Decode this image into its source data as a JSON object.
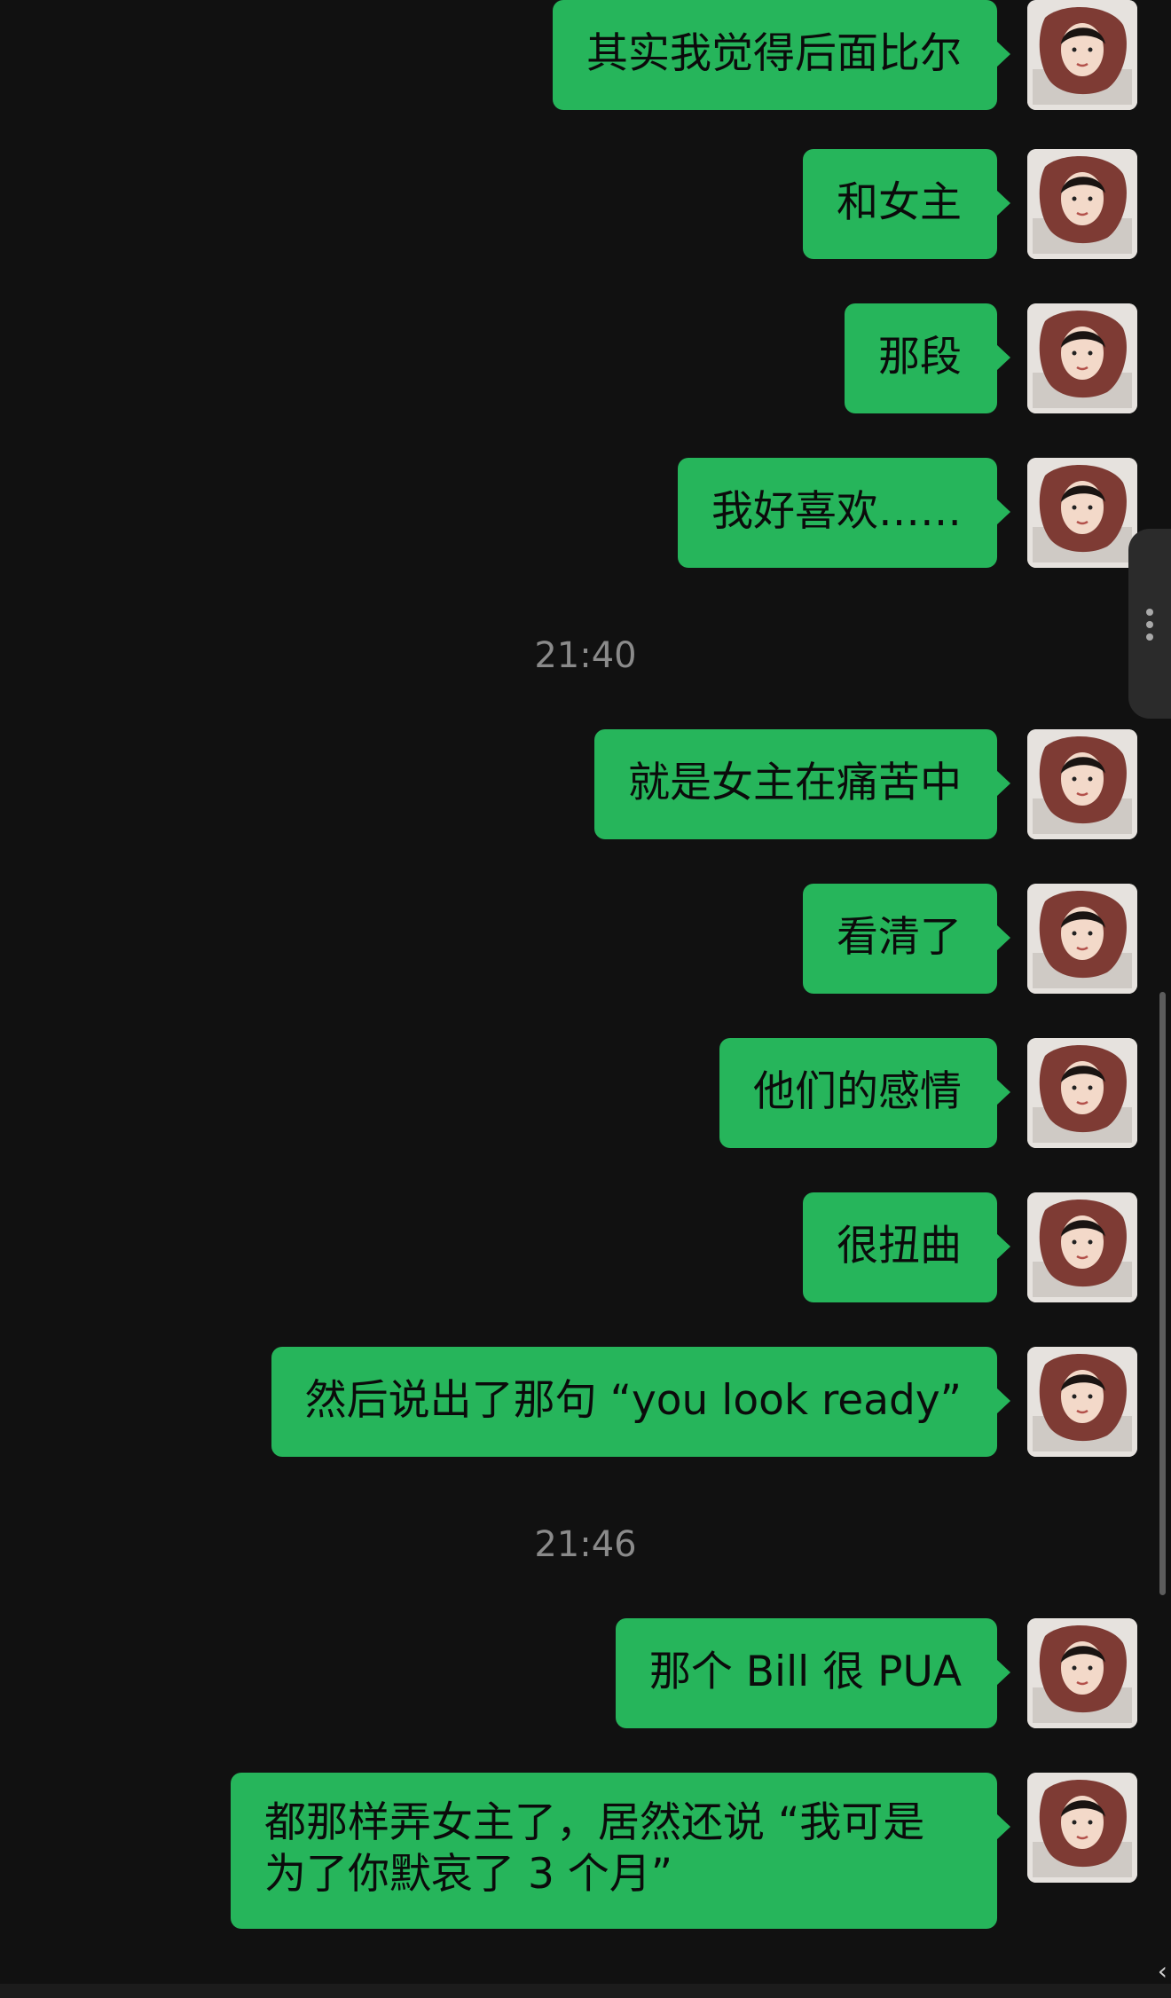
{
  "conversation": {
    "messages": [
      {
        "text": "其实我觉得后面比尔"
      },
      {
        "text": "和女主"
      },
      {
        "text": "那段"
      },
      {
        "text": "我好喜欢……"
      },
      {
        "text": "就是女主在痛苦中"
      },
      {
        "text": "看清了"
      },
      {
        "text": "他们的感情"
      },
      {
        "text": "很扭曲"
      },
      {
        "text": "然后说出了那句 “you look ready”"
      },
      {
        "text": "那个 Bill 很 PUA"
      },
      {
        "text": "都那样弄女主了，居然还说 “我可是为了你默哀了 3 个月”"
      }
    ],
    "timestamps": [
      "21:40",
      "21:46"
    ]
  },
  "colors": {
    "background": "#111111",
    "outgoing_bubble": "#26b55b",
    "timestamp_text": "#8a8a8a"
  },
  "icons": {
    "avatar": "user-avatar-photo",
    "side_handle": "more-vertical-icon"
  }
}
